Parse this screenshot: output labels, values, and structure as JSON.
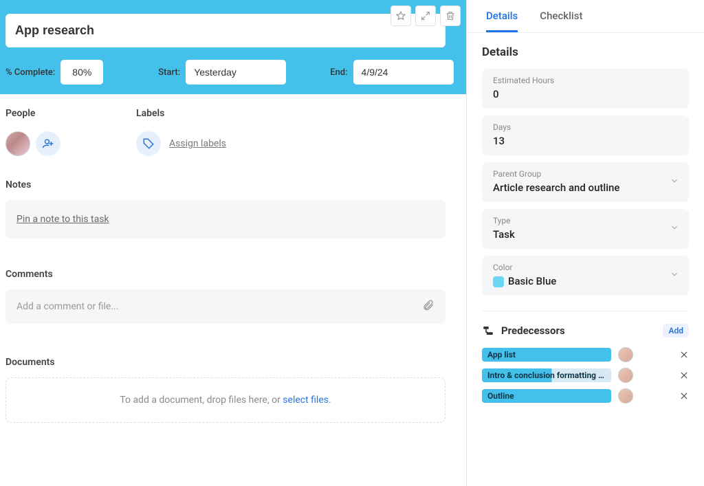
{
  "header": {
    "title": "App research",
    "complete_label": "% Complete:",
    "complete_value": "80%",
    "start_label": "Start:",
    "start_value": "Yesterday",
    "end_label": "End:",
    "end_value": "4/9/24"
  },
  "sections": {
    "people_title": "People",
    "labels_title": "Labels",
    "assign_labels": "Assign labels",
    "notes_title": "Notes",
    "pin_note": "Pin a note to this task",
    "comments_title": "Comments",
    "comment_placeholder": "Add a comment or file...",
    "documents_title": "Documents",
    "docs_hint_prefix": "To add a document, drop files here, or ",
    "docs_hint_link": "select files",
    "docs_hint_suffix": "."
  },
  "tabs": {
    "details": "Details",
    "checklist": "Checklist"
  },
  "details": {
    "heading": "Details",
    "fields": {
      "est_hours_label": "Estimated Hours",
      "est_hours_value": "0",
      "days_label": "Days",
      "days_value": "13",
      "parent_label": "Parent Group",
      "parent_value": "Article research and outline",
      "type_label": "Type",
      "type_value": "Task",
      "color_label": "Color",
      "color_value": "Basic Blue",
      "color_hex": "#6bd6f2"
    }
  },
  "predecessors": {
    "heading": "Predecessors",
    "add": "Add",
    "items": [
      {
        "label": "App list",
        "partial": false
      },
      {
        "label": "Intro & conclusion formatting and...",
        "partial": true
      },
      {
        "label": "Outline",
        "partial": false
      }
    ]
  },
  "icons": {
    "star": "star-icon",
    "expand": "expand-icon",
    "trash": "trash-icon",
    "add_person": "add-person-icon",
    "tag": "tag-icon",
    "attach": "attach-icon",
    "chevron": "chevron-down-icon",
    "pred": "predecessor-icon",
    "close": "close-icon"
  }
}
